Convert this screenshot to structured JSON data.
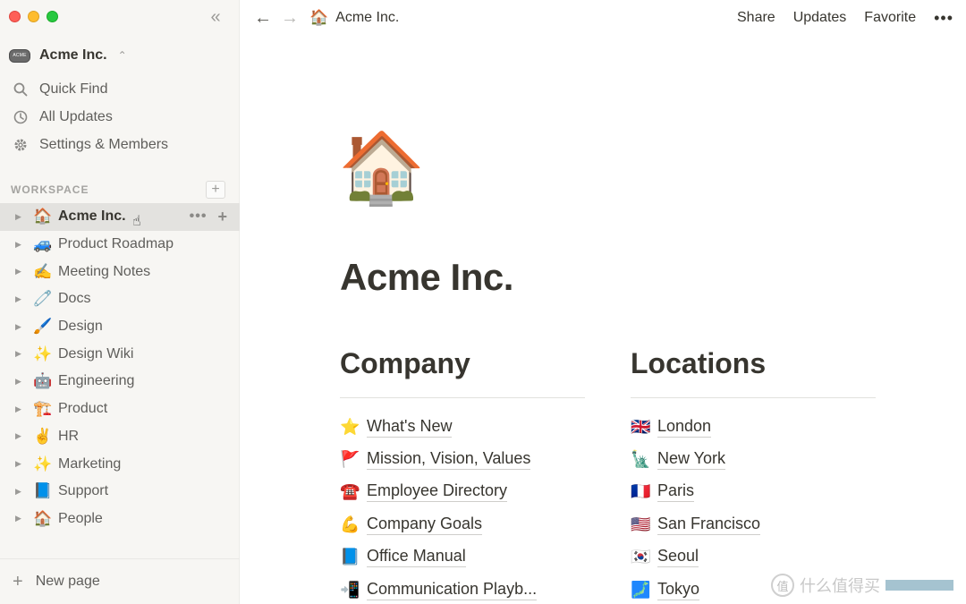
{
  "window": {
    "traffic_lights": [
      "close",
      "minimize",
      "zoom"
    ],
    "collapse_icon": "double-chevron-left-icon"
  },
  "workspace": {
    "logo_text": "ACME",
    "name": "Acme Inc.",
    "switch_icon": "updown-chevron-icon"
  },
  "nav": {
    "items": [
      {
        "label": "Quick Find",
        "icon": "search-icon"
      },
      {
        "label": "All Updates",
        "icon": "clock-icon"
      },
      {
        "label": "Settings & Members",
        "icon": "gear-icon"
      }
    ]
  },
  "sidebar_section": {
    "label": "WORKSPACE"
  },
  "pages": [
    {
      "emoji": "🏠",
      "label": "Acme Inc.",
      "active": true
    },
    {
      "emoji": "🚙",
      "label": "Product Roadmap"
    },
    {
      "emoji": "✍️",
      "label": "Meeting Notes"
    },
    {
      "emoji": "🧷",
      "label": "Docs"
    },
    {
      "emoji": "🖌️",
      "label": "Design"
    },
    {
      "emoji": "✨",
      "label": "Design Wiki"
    },
    {
      "emoji": "🤖",
      "label": "Engineering"
    },
    {
      "emoji": "🏗️",
      "label": "Product"
    },
    {
      "emoji": "✌️",
      "label": "HR"
    },
    {
      "emoji": "✨",
      "label": "Marketing"
    },
    {
      "emoji": "📘",
      "label": "Support"
    },
    {
      "emoji": "🏠",
      "label": "People"
    }
  ],
  "sidebar_footer": {
    "new_page_label": "New page"
  },
  "topbar": {
    "breadcrumb_emoji": "🏠",
    "breadcrumb_label": "Acme Inc.",
    "share_label": "Share",
    "updates_label": "Updates",
    "favorite_label": "Favorite"
  },
  "page": {
    "icon": "🏠",
    "title": "Acme Inc.",
    "columns": [
      {
        "heading": "Company",
        "links": [
          {
            "emoji": "⭐",
            "label": "What's New"
          },
          {
            "emoji": "🚩",
            "label": "Mission, Vision, Values"
          },
          {
            "emoji": "☎️",
            "label": "Employee Directory"
          },
          {
            "emoji": "💪",
            "label": "Company Goals"
          },
          {
            "emoji": "📘",
            "label": "Office Manual"
          },
          {
            "emoji": "📲",
            "label": "Communication Playb..."
          }
        ]
      },
      {
        "heading": "Locations",
        "links": [
          {
            "emoji": "🇬🇧",
            "label": "London"
          },
          {
            "emoji": "🗽",
            "label": "New York"
          },
          {
            "emoji": "🇫🇷",
            "label": "Paris"
          },
          {
            "emoji": "🇺🇸",
            "label": "San Francisco"
          },
          {
            "emoji": "🇰🇷",
            "label": "Seoul"
          },
          {
            "emoji": "🗾",
            "label": "Tokyo"
          }
        ]
      }
    ]
  },
  "watermark": {
    "circle_text": "值",
    "text": "什么值得买"
  }
}
